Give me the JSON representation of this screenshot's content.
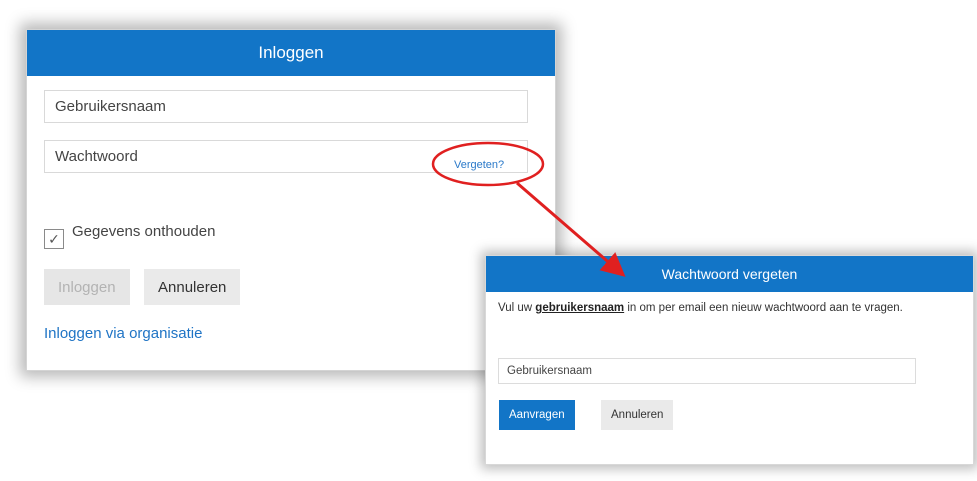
{
  "login": {
    "title": "Inloggen",
    "username_placeholder": "Gebruikersnaam",
    "password_placeholder": "Wachtwoord",
    "forgot_link": "Vergeten?",
    "remember_label": "Gegevens onthouden",
    "remember_checked": true,
    "checkbox_mark": "✓",
    "login_button": "Inloggen",
    "cancel_button": "Annuleren",
    "org_link": "Inloggen via organisatie"
  },
  "forgot": {
    "title": "Wachtwoord vergeten",
    "desc_before": "Vul uw ",
    "desc_bold": "gebruikersnaam",
    "desc_after": " in om per email een nieuw wachtwoord aan te vragen.",
    "username_placeholder": "Gebruikersnaam",
    "request_button": "Aanvragen",
    "cancel_button": "Annuleren"
  },
  "colors": {
    "header_blue": "#1275c7",
    "link_blue": "#2a79c9",
    "callout_red": "#e02020",
    "disabled_text": "#b3b3b3"
  }
}
